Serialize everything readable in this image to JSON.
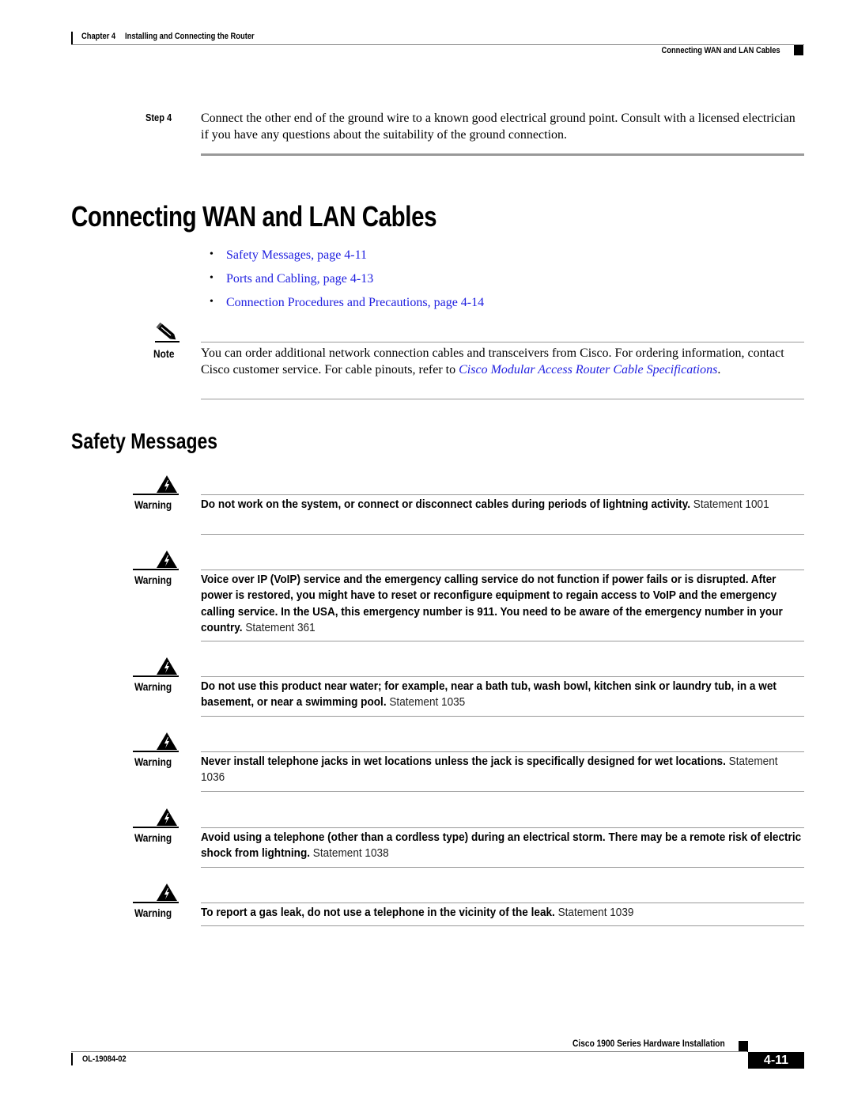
{
  "header": {
    "chapter_label": "Chapter 4",
    "chapter_title": "Installing and Connecting the Router",
    "section_title": "Connecting WAN and LAN Cables"
  },
  "step": {
    "label": "Step 4",
    "text": "Connect the other end of the ground wire to a known good electrical ground point. Consult with a licensed electrician if you have any questions about the suitability of the ground connection."
  },
  "heading": "Connecting WAN and LAN Cables",
  "toc": [
    {
      "bullet": "•",
      "label": "Safety Messages, page 4-11"
    },
    {
      "bullet": "•",
      "label": "Ports and Cabling, page 4-13"
    },
    {
      "bullet": "•",
      "label": "Connection Procedures and Precautions, page 4-14"
    }
  ],
  "note": {
    "label": "Note",
    "icon": "pencil-icon",
    "text_before": "You can order additional network connection cables and transceivers from Cisco. For ordering information, contact Cisco customer service. For cable pinouts, refer to ",
    "link": "Cisco Modular Access Router Cable Specifications",
    "text_after": "."
  },
  "subheading": "Safety Messages",
  "warnings": [
    {
      "label": "Warning",
      "icon": "warning-lightning-icon",
      "text": "Do not work on the system, or connect or disconnect cables during periods of lightning activity.",
      "statement": "Statement 1001"
    },
    {
      "label": "Warning",
      "icon": "warning-lightning-icon",
      "text": "Voice over IP (VoIP) service and the emergency calling service do not function if power fails or is disrupted. After power is restored, you might have to reset or reconfigure equipment to regain access to VoIP and the emergency calling service. In the USA, this emergency number is 911. You need to be aware of the emergency number in your country.",
      "statement": "Statement 361"
    },
    {
      "label": "Warning",
      "icon": "warning-lightning-icon",
      "text": "Do not use this product near water; for example, near a bath tub, wash bowl, kitchen sink or laundry tub, in a wet basement, or near a swimming pool.",
      "statement": "Statement 1035"
    },
    {
      "label": "Warning",
      "icon": "warning-lightning-icon",
      "text": "Never install telephone jacks in wet locations unless the jack is specifically designed for wet locations.",
      "statement": "Statement 1036"
    },
    {
      "label": "Warning",
      "icon": "warning-lightning-icon",
      "text": "Avoid using a telephone (other than a cordless type) during an electrical storm. There may be a remote risk of electric shock from lightning.",
      "statement": "Statement 1038"
    },
    {
      "label": "Warning",
      "icon": "warning-lightning-icon",
      "text": "To report a gas leak, do not use a telephone in the vicinity of the leak.",
      "statement": "Statement 1039"
    }
  ],
  "footer": {
    "book_title": "Cisco 1900 Series Hardware Installation",
    "doc_number": "OL-19084-02",
    "page_number": "4-11"
  },
  "colors": {
    "link": "#2020e0",
    "rule": "#999999",
    "text": "#000000"
  }
}
